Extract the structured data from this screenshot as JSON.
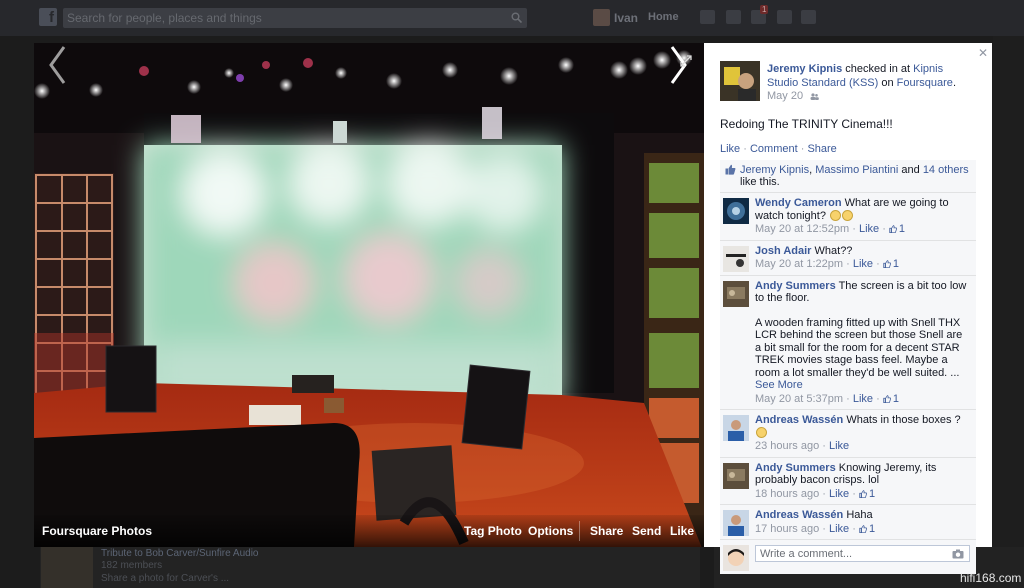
{
  "topbar": {
    "search_placeholder": "Search for people, places and things",
    "user_name": "Ivan",
    "home_label": "Home",
    "notification_count": "1"
  },
  "background": {
    "group_title": "Tribute to Bob Carver/Sunfire Audio",
    "group_members": "182 members",
    "group_desc": "Share a photo for Carver's ..."
  },
  "photo_bar": {
    "album": "Foursquare Photos",
    "tag_photo": "Tag Photo",
    "options": "Options",
    "share": "Share",
    "send": "Send",
    "like": "Like"
  },
  "post": {
    "author": "Jeremy Kipnis",
    "checked_in_text": "checked in at",
    "place": "Kipnis Studio Standard (KSS)",
    "on_text": "on",
    "app": "Foursquare",
    "date": "May 20",
    "text": "Redoing The TRINITY Cinema!!!",
    "actions": {
      "like": "Like",
      "comment": "Comment",
      "share": "Share"
    }
  },
  "likes": {
    "names": [
      "Jeremy Kipnis",
      "Massimo Piantini"
    ],
    "others": "14 others",
    "suffix": "like this."
  },
  "comments": [
    {
      "name": "Wendy Cameron",
      "text": "What are we going to watch tonight?",
      "emoji_count": 2,
      "time": "May 20 at 12:52pm",
      "like": "Like",
      "likes": "1"
    },
    {
      "name": "Josh Adair",
      "text": "What??",
      "emoji_count": 0,
      "time": "May 20 at 1:22pm",
      "like": "Like",
      "likes": "1"
    },
    {
      "name": "Andy Summers",
      "text": "The screen is a bit too low to the floor.",
      "text2": "A wooden framing fitted up with Snell THX LCR behind the screen but those Snell are a bit small for the room for a decent STAR TREK movies stage bass feel. Maybe a room a lot smaller they'd be well suited. ...",
      "see_more": "See More",
      "emoji_count": 0,
      "time": "May 20 at 5:37pm",
      "like": "Like",
      "likes": "1"
    },
    {
      "name": "Andreas Wassén",
      "text": "Whats in those boxes ?",
      "emoji_count": 1,
      "time": "23 hours ago",
      "like": "Like",
      "likes": ""
    },
    {
      "name": "Andy Summers",
      "text": "Knowing Jeremy, its probably bacon crisps. lol",
      "emoji_count": 0,
      "time": "18 hours ago",
      "like": "Like",
      "likes": "1"
    },
    {
      "name": "Andreas Wassén",
      "text": "Haha",
      "emoji_count": 0,
      "time": "17 hours ago",
      "like": "Like",
      "likes": "1"
    }
  ],
  "reply": {
    "placeholder": "Write a comment..."
  },
  "watermark": "hifi168.com",
  "colors": {
    "link": "#3b5998",
    "meta": "#9197a3",
    "ufi_bg": "#f6f7f9"
  }
}
